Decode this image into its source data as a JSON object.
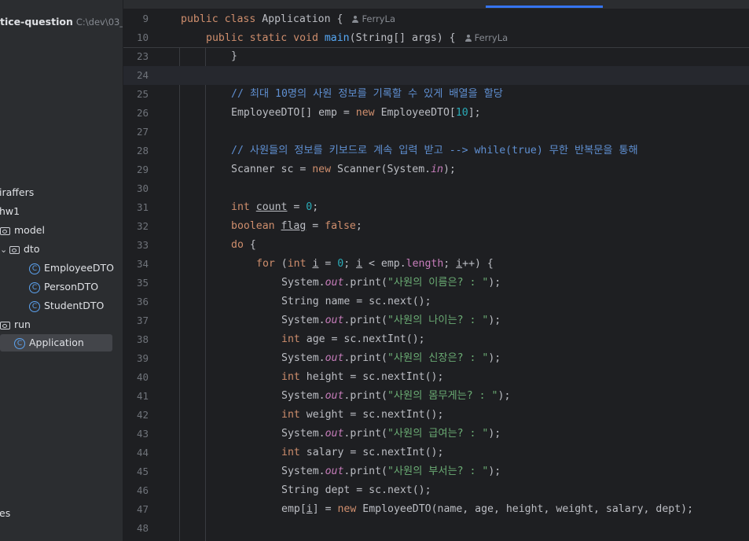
{
  "sidebar": {
    "project_name": "tice-question",
    "project_path": "C:\\dev\\03_J",
    "items": [
      {
        "label": "iraffers",
        "type": "text"
      },
      {
        "label": "hw1",
        "type": "text"
      },
      {
        "label": "model",
        "type": "folder"
      },
      {
        "label": "dto",
        "type": "folder-open"
      },
      {
        "label": "EmployeeDTO",
        "type": "class"
      },
      {
        "label": "PersonDTO",
        "type": "class"
      },
      {
        "label": "StudentDTO",
        "type": "class"
      },
      {
        "label": "run",
        "type": "folder"
      },
      {
        "label": "Application",
        "type": "run-class",
        "selected": true
      },
      {
        "label": "es",
        "type": "text"
      }
    ]
  },
  "editor": {
    "author": "FerryLa",
    "lines": [
      {
        "n": "9",
        "parts": [
          [
            "kw",
            "public class "
          ],
          [
            "",
            "Application {"
          ]
        ],
        "author": true
      },
      {
        "n": "10",
        "parts": [
          [
            "kw",
            "public static void "
          ],
          [
            "fn",
            "main"
          ],
          [
            "",
            "(String[] args) {"
          ]
        ],
        "author": true
      },
      {
        "n": "23",
        "parts": [
          [
            "",
            "}"
          ]
        ]
      },
      {
        "n": "24",
        "parts": [],
        "current": true
      },
      {
        "n": "25",
        "parts": [
          [
            "cmt",
            "// 최대 10명의 사원 정보를 기록할 수 있게 배열을 할당"
          ]
        ]
      },
      {
        "n": "26",
        "parts": [
          [
            "",
            "EmployeeDTO[] emp = "
          ],
          [
            "kw",
            "new "
          ],
          [
            "",
            "EmployeeDTO["
          ],
          [
            "num",
            "10"
          ],
          [
            "",
            "];"
          ]
        ]
      },
      {
        "n": "27",
        "parts": []
      },
      {
        "n": "28",
        "parts": [
          [
            "cmt",
            "// 사원들의 정보를 키보드로 계속 입력 받고 --> while(true) 무한 반복문을 통해"
          ]
        ]
      },
      {
        "n": "29",
        "parts": [
          [
            "",
            "Scanner sc = "
          ],
          [
            "kw",
            "new "
          ],
          [
            "",
            "Scanner(System."
          ],
          [
            "static",
            "in"
          ],
          [
            "",
            ");"
          ]
        ]
      },
      {
        "n": "30",
        "parts": []
      },
      {
        "n": "31",
        "parts": [
          [
            "kw",
            "int "
          ],
          [
            "ul",
            "count"
          ],
          [
            "",
            " = "
          ],
          [
            "num",
            "0"
          ],
          [
            "",
            ";"
          ]
        ]
      },
      {
        "n": "32",
        "parts": [
          [
            "kw",
            "boolean "
          ],
          [
            "ul",
            "flag"
          ],
          [
            "",
            " = "
          ],
          [
            "kw",
            "false"
          ],
          [
            "",
            ";"
          ]
        ]
      },
      {
        "n": "33",
        "parts": [
          [
            "kw",
            "do "
          ],
          [
            "",
            "{"
          ]
        ]
      },
      {
        "n": "34",
        "parts": [
          [
            "kw",
            "for "
          ],
          [
            "",
            "("
          ],
          [
            "kw",
            "int "
          ],
          [
            "ul",
            "i"
          ],
          [
            "",
            " = "
          ],
          [
            "num",
            "0"
          ],
          [
            "",
            "; "
          ],
          [
            "ul",
            "i"
          ],
          [
            "",
            " < emp."
          ],
          [
            "field",
            "length"
          ],
          [
            "",
            "; "
          ],
          [
            "ul",
            "i"
          ],
          [
            "",
            "++) {"
          ]
        ]
      },
      {
        "n": "35",
        "parts": [
          [
            "",
            "System."
          ],
          [
            "static",
            "out"
          ],
          [
            "",
            ".print("
          ],
          [
            "str",
            "\"사원의 이름은? : \""
          ],
          [
            "",
            ");"
          ]
        ]
      },
      {
        "n": "36",
        "parts": [
          [
            "",
            "String name = sc.next();"
          ]
        ]
      },
      {
        "n": "37",
        "parts": [
          [
            "",
            "System."
          ],
          [
            "static",
            "out"
          ],
          [
            "",
            ".print("
          ],
          [
            "str",
            "\"사원의 나이는? : \""
          ],
          [
            "",
            ");"
          ]
        ]
      },
      {
        "n": "38",
        "parts": [
          [
            "kw",
            "int "
          ],
          [
            "",
            "age = sc.nextInt();"
          ]
        ]
      },
      {
        "n": "39",
        "parts": [
          [
            "",
            "System."
          ],
          [
            "static",
            "out"
          ],
          [
            "",
            ".print("
          ],
          [
            "str",
            "\"사원의 신장은? : \""
          ],
          [
            "",
            ");"
          ]
        ]
      },
      {
        "n": "40",
        "parts": [
          [
            "kw",
            "int "
          ],
          [
            "",
            "height = sc.nextInt();"
          ]
        ]
      },
      {
        "n": "41",
        "parts": [
          [
            "",
            "System."
          ],
          [
            "static",
            "out"
          ],
          [
            "",
            ".print("
          ],
          [
            "str",
            "\"사원의 몸무게는? : \""
          ],
          [
            "",
            ");"
          ]
        ]
      },
      {
        "n": "42",
        "parts": [
          [
            "kw",
            "int "
          ],
          [
            "",
            "weight = sc.nextInt();"
          ]
        ]
      },
      {
        "n": "43",
        "parts": [
          [
            "",
            "System."
          ],
          [
            "static",
            "out"
          ],
          [
            "",
            ".print("
          ],
          [
            "str",
            "\"사원의 급여는? : \""
          ],
          [
            "",
            ");"
          ]
        ]
      },
      {
        "n": "44",
        "parts": [
          [
            "kw",
            "int "
          ],
          [
            "",
            "salary = sc.nextInt();"
          ]
        ]
      },
      {
        "n": "45",
        "parts": [
          [
            "",
            "System."
          ],
          [
            "static",
            "out"
          ],
          [
            "",
            ".print("
          ],
          [
            "str",
            "\"사원의 부서는? : \""
          ],
          [
            "",
            ");"
          ]
        ]
      },
      {
        "n": "46",
        "parts": [
          [
            "",
            "String dept = sc.next();"
          ]
        ]
      },
      {
        "n": "47",
        "parts": [
          [
            "",
            "emp["
          ],
          [
            "ul",
            "i"
          ],
          [
            "",
            "] = "
          ],
          [
            "kw",
            "new "
          ],
          [
            "",
            "EmployeeDTO(name, age, height, weight, salary, dept);"
          ]
        ]
      },
      {
        "n": "48",
        "parts": []
      }
    ]
  }
}
